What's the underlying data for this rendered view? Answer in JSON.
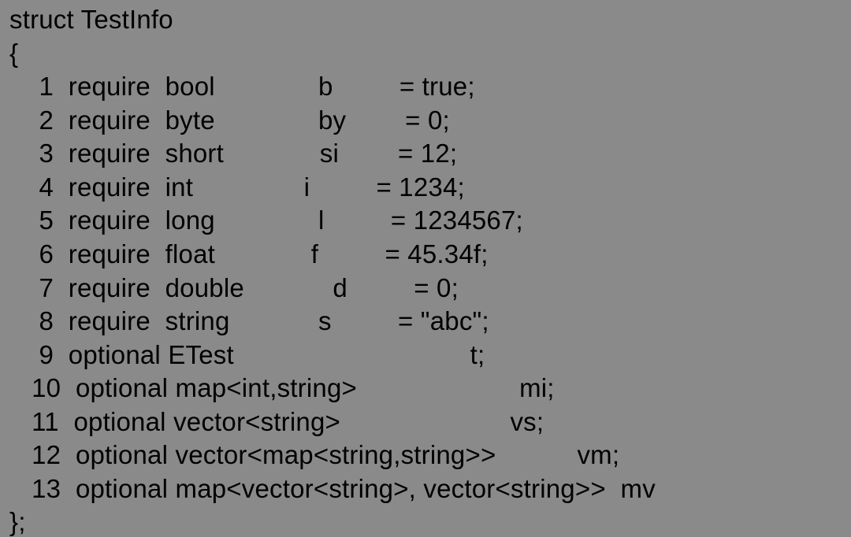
{
  "struct_name": "TestInfo",
  "open_brace": "{",
  "close": "};",
  "fields": [
    {
      "num": "1",
      "qualifier": "require",
      "type": "bool",
      "name": "b",
      "value": "= true;"
    },
    {
      "num": "2",
      "qualifier": "require",
      "type": "byte",
      "name": "by",
      "value": "= 0;"
    },
    {
      "num": "3",
      "qualifier": "require",
      "type": "short",
      "name": "si",
      "value": "= 12;"
    },
    {
      "num": "4",
      "qualifier": "require",
      "type": "int",
      "name": "i",
      "value": "= 1234;"
    },
    {
      "num": "5",
      "qualifier": "require",
      "type": "long",
      "name": "l",
      "value": "= 1234567;"
    },
    {
      "num": "6",
      "qualifier": "require",
      "type": "float",
      "name": "f",
      "value": "= 45.34f;"
    },
    {
      "num": "7",
      "qualifier": "require",
      "type": "double",
      "name": "d",
      "value": "= 0;"
    },
    {
      "num": "8",
      "qualifier": "require",
      "type": "string",
      "name": "s",
      "value": "= \"abc\";"
    },
    {
      "num": "9",
      "qualifier": "optional",
      "type": "ETest",
      "name": "t;",
      "value": ""
    },
    {
      "num": "10",
      "qualifier": "optional",
      "type": "map<int,string>",
      "name": "mi;",
      "value": ""
    },
    {
      "num": "11",
      "qualifier": "optional",
      "type": "vector<string>",
      "name": "vs;",
      "value": ""
    },
    {
      "num": "12",
      "qualifier": "optional",
      "type": "vector<map<string,string>>",
      "name": "vm;",
      "value": ""
    },
    {
      "num": "13",
      "qualifier": "optional",
      "type": "map<vector<string>, vector<string>>",
      "name": "mv",
      "value": ""
    }
  ]
}
